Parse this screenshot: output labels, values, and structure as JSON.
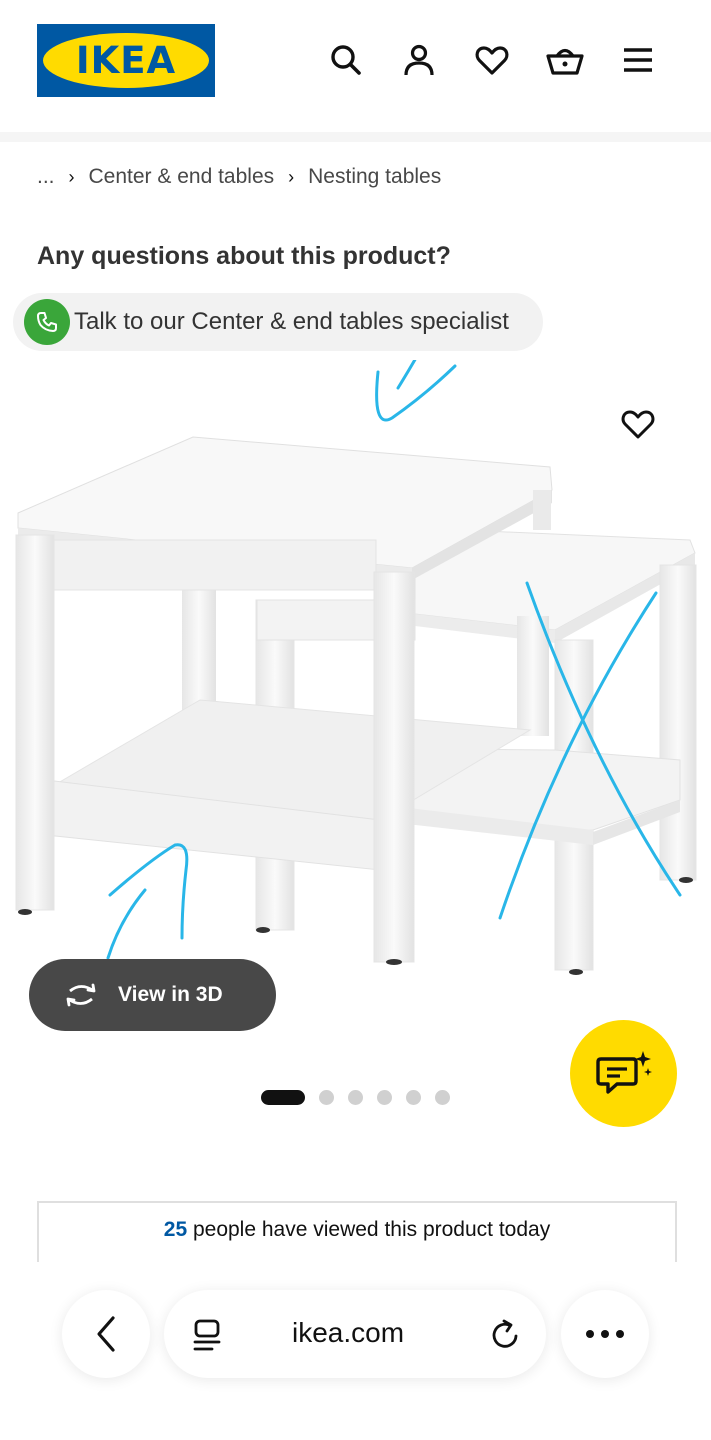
{
  "header": {
    "logo_text": "IKEA",
    "logo_registered": "®",
    "icons": [
      "search-icon",
      "account-icon",
      "favorites-icon",
      "basket-icon",
      "menu-icon"
    ]
  },
  "breadcrumb": {
    "ellipsis": "...",
    "items": [
      "Center & end tables",
      "Nesting tables"
    ]
  },
  "support": {
    "question": "Any questions about this product?",
    "specialist_label": "Talk to our Center & end tables specialist"
  },
  "product": {
    "view_3d_label": "View in 3D",
    "carousel": {
      "total_images": 6,
      "active_index": 0
    }
  },
  "viewers": {
    "count": "25",
    "text": "people have viewed this product today"
  },
  "browser": {
    "url": "ikea.com"
  },
  "colors": {
    "brand_blue": "#0058a3",
    "brand_yellow": "#ffdb00",
    "phone_green": "#3aa63a",
    "annotation_blue": "#29b6e8"
  }
}
